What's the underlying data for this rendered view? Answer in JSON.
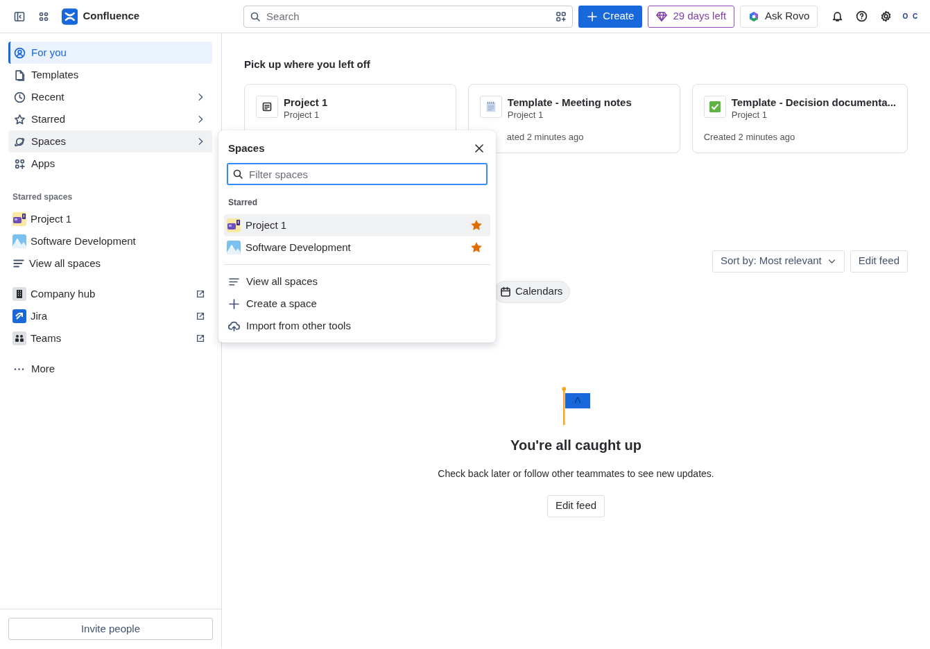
{
  "topbar": {
    "app_name": "Confluence",
    "search": {
      "placeholder": "Search"
    },
    "create_label": "Create",
    "trial_label": "29 days left",
    "rovo_label": "Ask Rovo",
    "avatar": "O C"
  },
  "sidebar": {
    "items": [
      {
        "label": "For you",
        "kind": "user",
        "selected": true,
        "hovered": false,
        "chevron": false
      },
      {
        "label": "Templates",
        "kind": "templates",
        "selected": false,
        "hovered": false,
        "chevron": false
      },
      {
        "label": "Recent",
        "kind": "clock",
        "selected": false,
        "hovered": false,
        "chevron": true
      },
      {
        "label": "Starred",
        "kind": "star",
        "selected": false,
        "hovered": false,
        "chevron": true
      },
      {
        "label": "Spaces",
        "kind": "planet",
        "selected": false,
        "hovered": true,
        "chevron": true
      },
      {
        "label": "Apps",
        "kind": "apps",
        "selected": false,
        "hovered": false,
        "chevron": false
      }
    ],
    "starred_heading": "Starred spaces",
    "spaces": [
      {
        "label": "Project 1",
        "kind": "project"
      },
      {
        "label": "Software Development",
        "kind": "mountain"
      },
      {
        "label": "View all spaces",
        "kind": "lines"
      }
    ],
    "links": [
      {
        "label": "Company hub",
        "kind": "building"
      },
      {
        "label": "Jira",
        "kind": "jira"
      },
      {
        "label": "Teams",
        "kind": "people"
      }
    ],
    "more": "More",
    "invite": "Invite people"
  },
  "main": {
    "heading": "Pick up where you left off",
    "cards": [
      {
        "title": "Project 1",
        "space": "Project 1",
        "kind": "page"
      },
      {
        "title": "Template - Meeting notes",
        "space": "Project 1",
        "footer": "ated 2 minutes ago",
        "kind": "notepad"
      },
      {
        "title": "Template - Decision documenta...",
        "space": "Project 1",
        "footer": "Created 2 minutes ago",
        "kind": "check"
      }
    ],
    "sort_label": "Sort by: Most relevant",
    "edit_feed": "Edit feed",
    "filters": [
      {
        "label": "Calendars"
      }
    ],
    "empty": {
      "title": "You're all caught up",
      "text": "Check back later or follow other teammates to see new updates.",
      "button": "Edit feed"
    }
  },
  "popover": {
    "title": "Spaces",
    "filter": {
      "placeholder": "Filter spaces"
    },
    "section": "Starred",
    "spaces": [
      {
        "label": "Project 1",
        "kind": "project",
        "selected": true,
        "starred": true
      },
      {
        "label": "Software Development",
        "kind": "mountain",
        "selected": false,
        "starred": true
      }
    ],
    "actions": [
      {
        "label": "View all spaces",
        "kind": "lines"
      },
      {
        "label": "Create a space",
        "kind": "plus"
      },
      {
        "label": "Import from other tools",
        "kind": "upload"
      }
    ]
  }
}
